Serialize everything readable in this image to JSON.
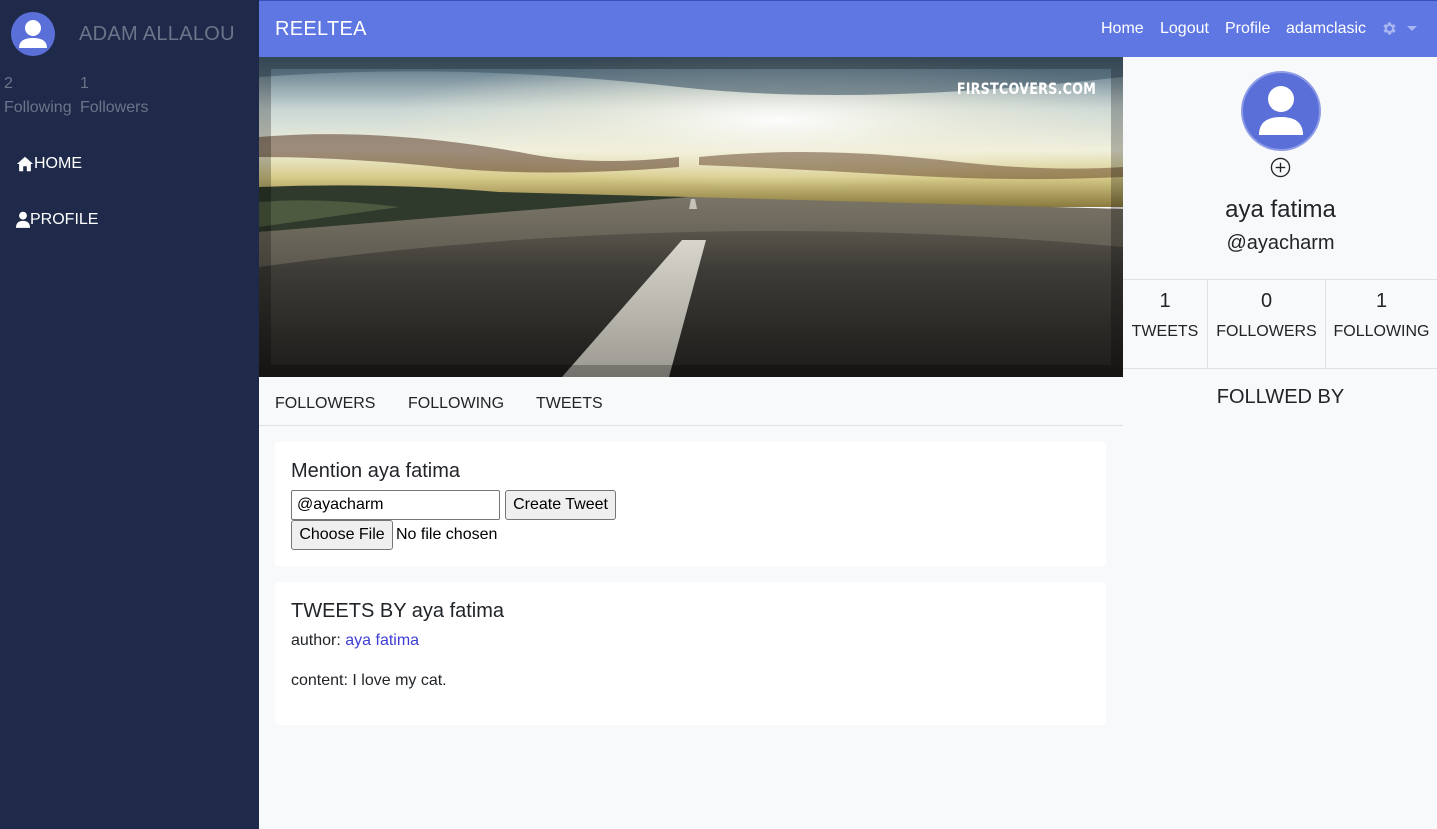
{
  "sidebar": {
    "user_name": "ADAM ALLALOU",
    "following_count": "2",
    "following_label": "Following",
    "followers_count": "1",
    "followers_label": "Followers",
    "nav": [
      {
        "label": "HOME",
        "icon": "home-icon"
      },
      {
        "label": "PROFILE",
        "icon": "user-icon"
      }
    ]
  },
  "topbar": {
    "brand": "REELTEA",
    "links": [
      "Home",
      "Logout",
      "Profile",
      "adamclasic"
    ],
    "settings_icon": "gear-icon",
    "accent": "#5f77e3"
  },
  "cover": {
    "watermark": "FIRSTCOVERS.COM"
  },
  "tabs": [
    "FOLLOWERS",
    "FOLLOWING",
    "TWEETS"
  ],
  "mention": {
    "title": "Mention aya fatima",
    "input_value": "@ayacharm",
    "create_button": "Create Tweet",
    "file_button": "Choose File",
    "file_status": "No file chosen"
  },
  "tweets": {
    "title": "TWEETS BY aya fatima",
    "author_label": "author: ",
    "author_name": "aya fatima",
    "content_line": "content: I love my cat."
  },
  "profile": {
    "name": "aya fatima",
    "handle": "@ayacharm",
    "stats": [
      {
        "count": "1",
        "label": "TWEETS"
      },
      {
        "count": "0",
        "label": "FOLLOWERS"
      },
      {
        "count": "1",
        "label": "FOLLOWING"
      }
    ],
    "followed_by_heading": "FOLLWED BY"
  }
}
